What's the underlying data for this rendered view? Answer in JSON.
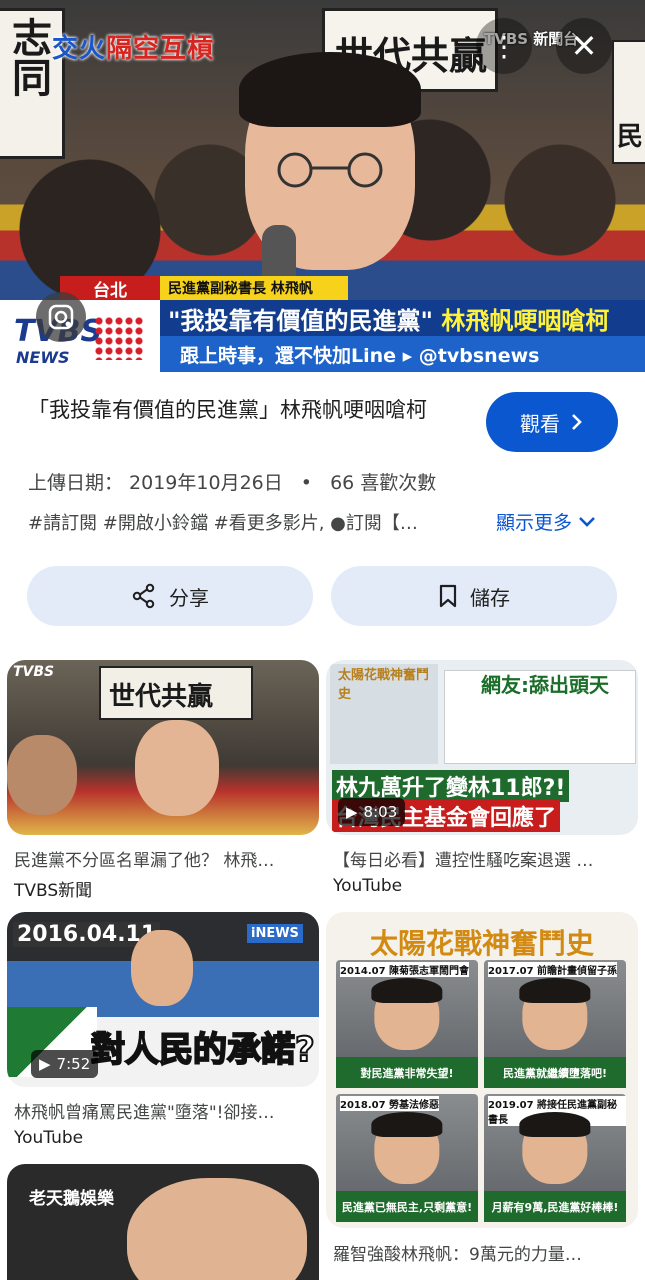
{
  "hero": {
    "segment_label_blue": "交火",
    "segment_label_red": "隔空互槓",
    "brand": "TVBS 新聞台",
    "sign_mid": "世代共贏",
    "sign_left": "志同",
    "sign_right": "民",
    "location": "台北",
    "person_caption": "民進黨副秘書長 林飛帆",
    "headline_quote": "\"我投靠有價值的民進黨\"",
    "headline_name": "林飛帆哽咽嗆柯",
    "subline": "跟上時事，還不快加Line ▸ @tvbsnews",
    "logo_tvbs": "TVBS",
    "logo_news": "NEWS",
    "more_icon": "⋮",
    "close_icon": "✕"
  },
  "video": {
    "title": "「我投靠有價值的民進黨」林飛帆哽咽嗆柯",
    "watch_label": "觀看",
    "upload_date": "上傳日期： 2019年10月26日",
    "separator": "•",
    "likes": "66 喜歡次數",
    "tags": "#請訂閱 #開啟小鈴鐺 #看更多影片, ●訂閱【…",
    "show_more": "顯示更多"
  },
  "actions": {
    "share_label": "分享",
    "save_label": "儲存"
  },
  "related": [
    {
      "title": "民進黨不分區名單漏了他？ 林飛…",
      "source": "TVBS新聞",
      "overlay": "世代共贏",
      "logo": "TVBS"
    },
    {
      "title": "【每日必看】遭控性騷吃案退選 …",
      "source": "YouTube",
      "duration": "8:03",
      "top_label": "太陽花戰神奮鬥史",
      "banner": "網友:舔出頭天",
      "caption1": "林九萬升了變林11郎?!",
      "caption2": "台灣民主基金會回應了"
    },
    {
      "title": "林飛帆曾痛罵民進黨\"墮落\"!卻接…",
      "source": "YouTube",
      "duration": "7:52",
      "date_label": "2016.04.11",
      "caption": "對人民的承諾?",
      "channel": "iNEWS"
    },
    {
      "title": "羅智強酸林飛帆：9萬元的力量…",
      "source": "",
      "top_label": "太陽花戰神奮鬥史",
      "tiles": [
        {
          "date": "2014.07 陳菊張志軍鬧門會",
          "cap": "對民進黨非常失望!"
        },
        {
          "date": "2017.07 前瞻計畫偵留子孫",
          "cap": "民進黨就繼續墮落吧!"
        },
        {
          "date": "2018.07 勞基法修惡",
          "cap": "民進黨已無民主,只剩黨意!"
        },
        {
          "date": "2019.07 將接任民進黨副秘書長",
          "cap": "月薪有9萬,民進黨好棒棒!"
        }
      ]
    },
    {
      "title": "",
      "source": "",
      "overlay": "老天鵝娛樂"
    }
  ]
}
